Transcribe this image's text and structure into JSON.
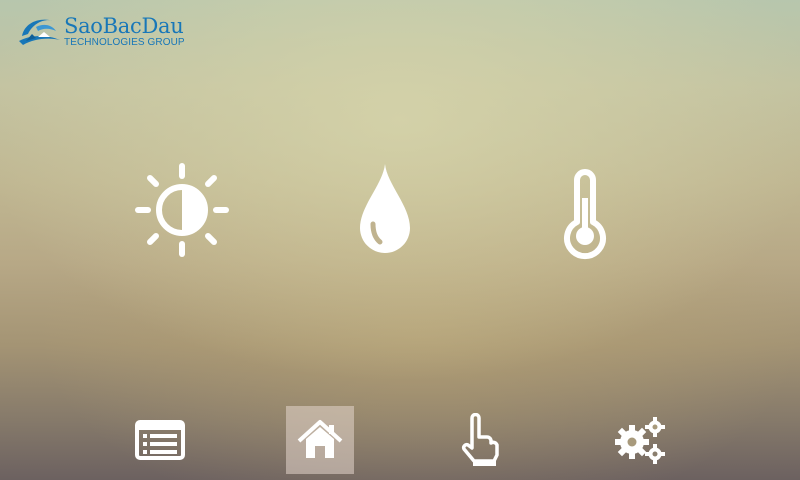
{
  "logo": {
    "name": "SaoBacDau",
    "tagline": "TECHNOLOGIES GROUP",
    "color": "#1877b8"
  },
  "controls": [
    {
      "id": "brightness",
      "icon": "brightness-icon"
    },
    {
      "id": "humidity",
      "icon": "water-drop-icon"
    },
    {
      "id": "temperature",
      "icon": "thermometer-icon"
    }
  ],
  "bottom_nav": [
    {
      "id": "list",
      "icon": "list-icon",
      "active": false
    },
    {
      "id": "home",
      "icon": "home-icon",
      "active": true
    },
    {
      "id": "touch",
      "icon": "touch-hand-icon",
      "active": false
    },
    {
      "id": "settings",
      "icon": "gears-icon",
      "active": false
    }
  ],
  "colors": {
    "icon": "#ffffff",
    "active_tab_bg": "#e4d6cc"
  }
}
